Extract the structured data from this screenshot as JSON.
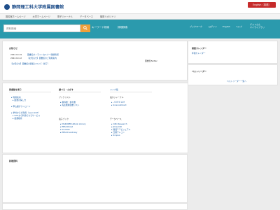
{
  "header": {
    "title": "静岡理工科大学附属図書館",
    "english_button": "English（英語）"
  },
  "nav": [
    "図書館ホームページ",
    "大学ホームページ",
    "電子ジャーナル",
    "データベース",
    "機関リポジトリ"
  ],
  "search": {
    "placeholder": "資料検索",
    "button_icon": "search-icon",
    "links": [
      "キーワード検索",
      "詳細検索"
    ]
  },
  "top_links": [
    "ブックマーク",
    "ログイン",
    "English",
    "ヘルプ"
  ],
  "user": {
    "line1": "ゲストさん",
    "line2": "マイライブラリ"
  },
  "notice": {
    "title": "お知らせ",
    "items": [
      {
        "date": "2022.10.19",
        "text": "図書館オンラインセミナー開催情報"
      },
      {
        "date": "2022.10.12",
        "text": "【お知らせ】図書館のご利用案内"
      }
    ],
    "extra": "【お知らせ】図書館の開館について（終了）",
    "twitter": "図書館Twitter"
  },
  "calendar": {
    "title": "開館カレンダー",
    "link": "年間カレンダー"
  },
  "bestreader": {
    "title": "ベストリーダー",
    "link": "ベストリーダー一覧へ"
  },
  "links": {
    "col1": {
      "title": "図書館を使う",
      "items": [
        "利用案内",
        "図書の探し方",
        "申込書ダウンロード",
        "学外からの利用（Lean SiST）",
        "SiSTから利用できるサービス",
        "蔵書検索"
      ]
    },
    "col2": {
      "title": "調べる・さがす",
      "sub": "ブックリスト",
      "items": [
        "教科書・参考書",
        "先生推薦図書リスト"
      ],
      "ebook_title": "電子ブック",
      "ebook_items": [
        "MARUZEN eBook Library",
        "EBSCOhost",
        "KinoDen",
        "EBSCO eLibrary"
      ]
    },
    "col3": {
      "title": "リンク集",
      "ejournal_title": "電子ジャーナル",
      "ejournal_items": [
        "ＪＤＲＥＡＭ",
        "ScienceDirect"
      ],
      "db_title": "データベース",
      "db_items": [
        "CiNii Research",
        "JDreamIII",
        "聞蔵ＩＩビジュアル",
        "日経テレコン",
        "Scopus"
      ]
    }
  },
  "new_items": {
    "title": "新着資料"
  }
}
